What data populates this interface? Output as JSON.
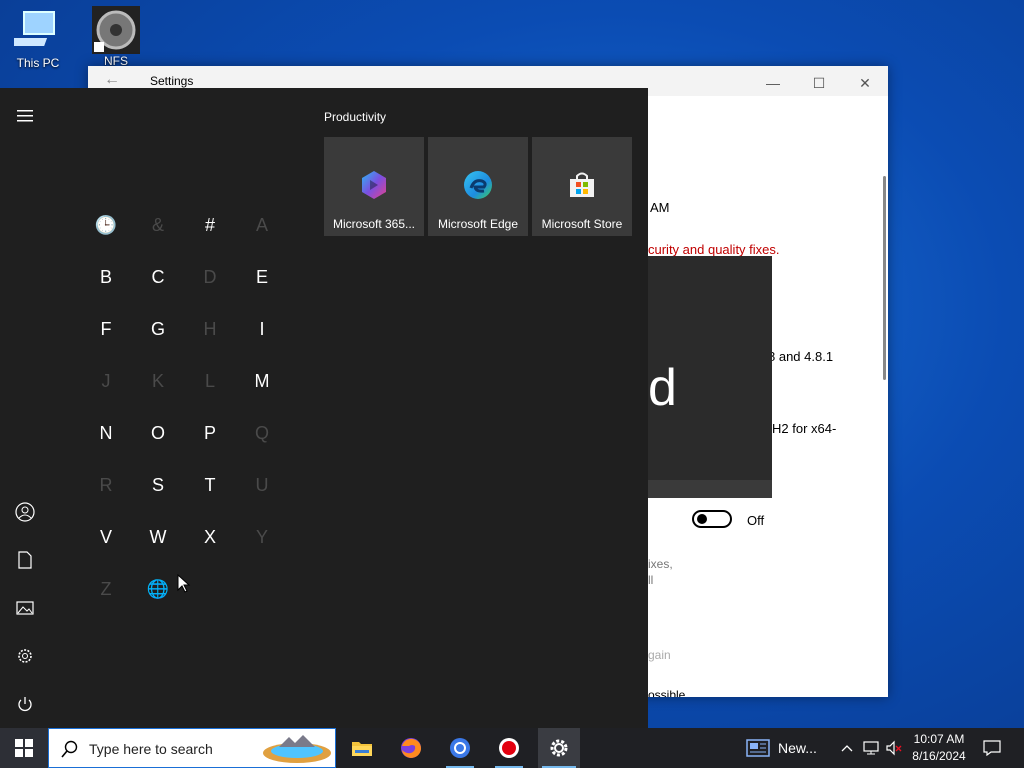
{
  "desktop": {
    "icons": [
      {
        "label": "This PC"
      },
      {
        "label": "NFS"
      }
    ]
  },
  "settings_window": {
    "title": "Settings",
    "fragments": {
      "time": "AM",
      "red_text": "curity and quality fixes.",
      "line1": "8 and 4.8.1",
      "line2": "H2 for x64-",
      "toggle_label": "Off",
      "grey1": "ixes,",
      "grey2": "ll",
      "grey3": "gain",
      "bottom_cut": "ossible"
    }
  },
  "start_menu": {
    "alphabet": [
      {
        "char": "🕒",
        "dim": false
      },
      {
        "char": "&",
        "dim": true
      },
      {
        "char": "#",
        "dim": false
      },
      {
        "char": "A",
        "dim": true
      },
      {
        "char": "B",
        "dim": false
      },
      {
        "char": "C",
        "dim": false
      },
      {
        "char": "D",
        "dim": true
      },
      {
        "char": "E",
        "dim": false
      },
      {
        "char": "F",
        "dim": false
      },
      {
        "char": "G",
        "dim": false
      },
      {
        "char": "H",
        "dim": true
      },
      {
        "char": "I",
        "dim": false
      },
      {
        "char": "J",
        "dim": true
      },
      {
        "char": "K",
        "dim": true
      },
      {
        "char": "L",
        "dim": true
      },
      {
        "char": "M",
        "dim": false
      },
      {
        "char": "N",
        "dim": false
      },
      {
        "char": "O",
        "dim": false
      },
      {
        "char": "P",
        "dim": false
      },
      {
        "char": "Q",
        "dim": true
      },
      {
        "char": "R",
        "dim": true
      },
      {
        "char": "S",
        "dim": false
      },
      {
        "char": "T",
        "dim": false
      },
      {
        "char": "U",
        "dim": true
      },
      {
        "char": "V",
        "dim": false
      },
      {
        "char": "W",
        "dim": false
      },
      {
        "char": "X",
        "dim": false
      },
      {
        "char": "Y",
        "dim": true
      },
      {
        "char": "Z",
        "dim": true
      },
      {
        "char": "🌐",
        "dim": true
      }
    ],
    "group_label": "Productivity",
    "tiles": [
      {
        "name": "Microsoft 365...",
        "icon": "microsoft-365-icon"
      },
      {
        "name": "Microsoft Edge",
        "icon": "edge-icon"
      },
      {
        "name": "Microsoft Store",
        "icon": "store-icon"
      }
    ],
    "rail_icons": [
      "hamburger-icon",
      "user-icon",
      "documents-icon",
      "pictures-icon",
      "settings-icon",
      "power-icon"
    ]
  },
  "taskbar": {
    "search_placeholder": "Type here to search",
    "news_label": "New...",
    "clock_time": "10:07 AM",
    "clock_date": "8/16/2024",
    "pinned": [
      "file-explorer-icon",
      "firefox-icon",
      "chrome-icon",
      "record-icon",
      "settings-icon"
    ]
  }
}
